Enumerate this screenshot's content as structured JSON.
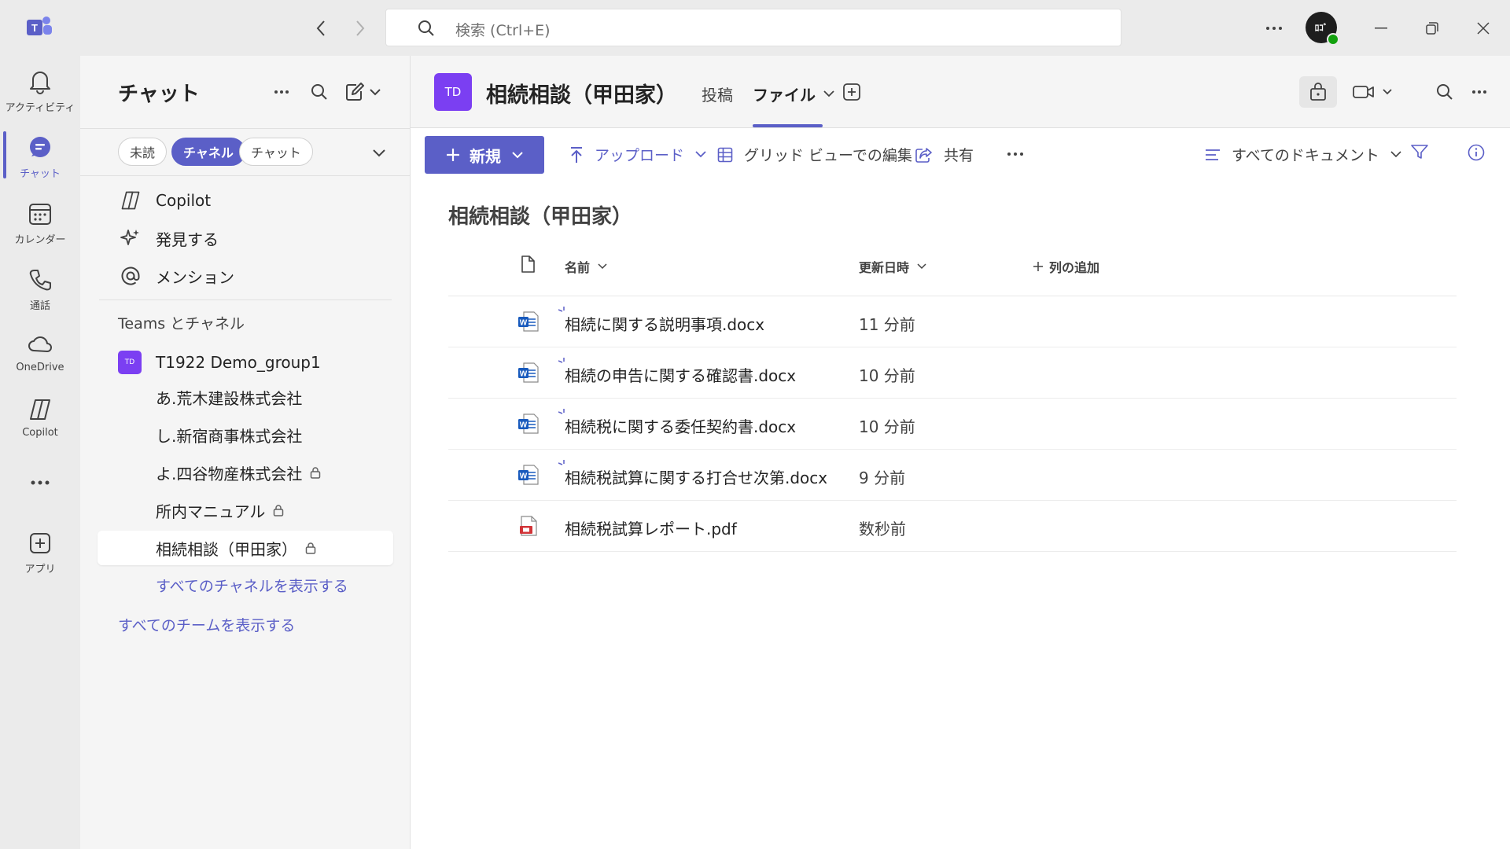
{
  "titlebar": {
    "search_placeholder": "検索 (Ctrl+E)",
    "avatar_initials": "ﾛｺﾞ"
  },
  "rail": {
    "items": [
      {
        "label": "アクティビティ",
        "icon": "bell-icon"
      },
      {
        "label": "チャット",
        "icon": "chat-icon",
        "active": true
      },
      {
        "label": "カレンダー",
        "icon": "calendar-icon"
      },
      {
        "label": "通話",
        "icon": "phone-icon"
      },
      {
        "label": "OneDrive",
        "icon": "cloud-icon"
      },
      {
        "label": "Copilot",
        "icon": "copilot-icon"
      },
      {
        "label": "アプリ",
        "icon": "add-app-icon"
      }
    ]
  },
  "chatpane": {
    "title": "チャット",
    "filters": [
      "未読",
      "チャネル",
      "チャット"
    ],
    "quick": [
      "Copilot",
      "発見する",
      "メンション"
    ],
    "section_label": "Teams とチャネル",
    "team": {
      "badge": "TD",
      "name": "T1922 Demo_group1"
    },
    "channels": [
      "あ.荒木建設株式会社",
      "し.新宿商事株式会社",
      "よ.四谷物産株式会社",
      "所内マニュアル",
      "相続相談（甲田家）"
    ],
    "show_all_channels": "すべてのチャネルを表示する",
    "show_all_teams": "すべてのチームを表示する"
  },
  "header": {
    "badge": "TD",
    "title": "相続相談（甲田家）",
    "tabs": [
      "投稿",
      "ファイル"
    ]
  },
  "toolbar": {
    "new_label": "新規",
    "upload_label": "アップロード",
    "grid_label": "グリッド ビューでの編集",
    "share_label": "共有",
    "view_label": "すべてのドキュメント"
  },
  "library": {
    "title": "相続相談（甲田家）",
    "columns": {
      "name": "名前",
      "modified": "更新日時",
      "add": "列の追加"
    },
    "files": [
      {
        "name": "相続に関する説明事項.docx",
        "modified": "11 分前",
        "type": "word"
      },
      {
        "name": "相続の申告に関する確認書.docx",
        "modified": "10 分前",
        "type": "word"
      },
      {
        "name": "相続税に関する委任契約書.docx",
        "modified": "10 分前",
        "type": "word"
      },
      {
        "name": "相続税試算に関する打合せ次第.docx",
        "modified": "9 分前",
        "type": "word"
      },
      {
        "name": "相続税試算レポート.pdf",
        "modified": "数秒前",
        "type": "pdf"
      }
    ]
  },
  "colors": {
    "accent": "#5b5fc7",
    "team_badge": "#7b3ff2",
    "word_blue": "#185abd",
    "pdf_red": "#d13438"
  }
}
